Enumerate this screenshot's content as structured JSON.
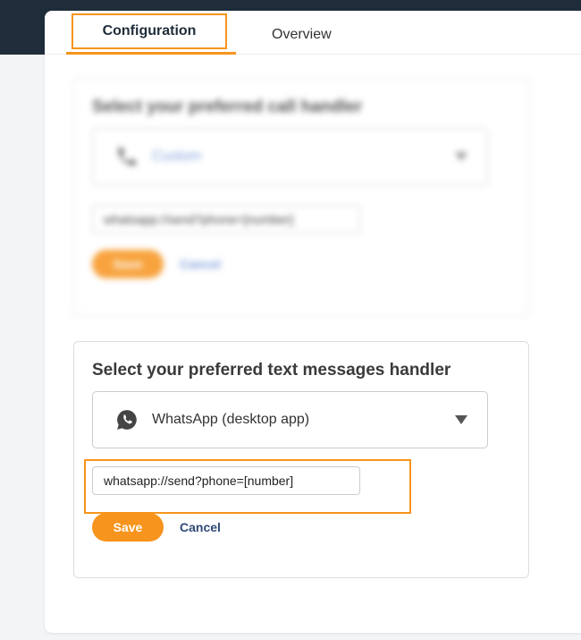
{
  "tabs": {
    "configuration": "Configuration",
    "overview": "Overview"
  },
  "call_handler": {
    "title": "Select your preferred call handler",
    "selected": "Custom",
    "url_value": "whatsapp://send?phone=[number]",
    "save_label": "Save",
    "cancel_label": "Cancel",
    "icon": "phone-icon"
  },
  "text_handler": {
    "title": "Select your preferred text messages handler",
    "selected": "WhatsApp (desktop app)",
    "url_value": "whatsapp://send?phone=[number]",
    "save_label": "Save",
    "cancel_label": "Cancel",
    "icon": "whatsapp-icon"
  },
  "colors": {
    "accent": "#f7941d",
    "topbar": "#1f2d3a",
    "link": "#2f4a7a"
  }
}
